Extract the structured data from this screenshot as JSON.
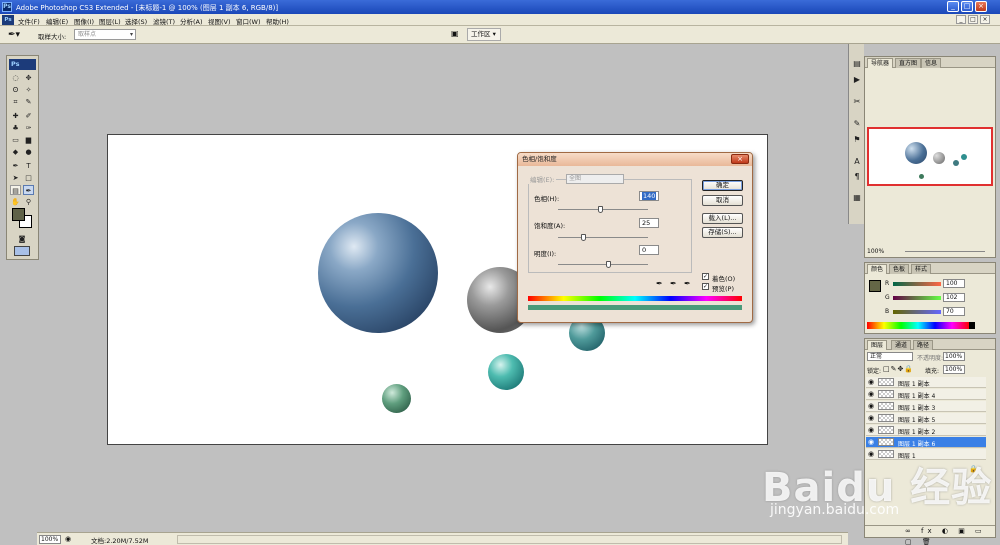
{
  "window": {
    "title": "Adobe Photoshop CS3 Extended - [未标题-1 @ 100% (图层 1 副本 6, RGB/8)]",
    "minimize": "_",
    "maximize": "□",
    "close": "×"
  },
  "menu": {
    "items": [
      "文件(F)",
      "编辑(E)",
      "图像(I)",
      "图层(L)",
      "选择(S)",
      "滤镜(T)",
      "分析(A)",
      "视图(V)",
      "窗口(W)",
      "帮助(H)"
    ],
    "doc_buttons": [
      "_",
      "□",
      "×"
    ]
  },
  "options": {
    "sample_size_label": "取样大小:",
    "sample_size_value": "取样点",
    "workspace_label": "工作区 ▾"
  },
  "toolbox": {
    "logo": "Ps"
  },
  "status": {
    "zoom": "100%",
    "doc_info": "文档:2.20M/7.52M"
  },
  "dialog": {
    "title": "色相/饱和度",
    "edit_label": "编辑(E):",
    "edit_value": "全图",
    "hue_label": "色相(H):",
    "hue_value": "140",
    "saturation_label": "饱和度(A):",
    "saturation_value": "25",
    "lightness_label": "明度(I):",
    "lightness_value": "0",
    "ok": "确定",
    "cancel": "取消",
    "load": "载入(L)...",
    "save": "存储(S)...",
    "colorize_label": "着色(O)",
    "colorize_checked": true,
    "preview_label": "预览(P)",
    "preview_checked": true
  },
  "navigator": {
    "tabs": [
      "导航器",
      "直方图",
      "信息"
    ],
    "zoom": "100%",
    "highlight_color": "#e03030"
  },
  "color_panel": {
    "tabs": [
      "颜色",
      "色板",
      "样式"
    ],
    "r_label": "R",
    "g_label": "G",
    "b_label": "B",
    "r_value": "100",
    "g_value": "102",
    "b_value": "70",
    "fg_color": "#646646"
  },
  "layers_panel": {
    "tabs": [
      "图层",
      "通道",
      "路径"
    ],
    "blend_mode": "正常",
    "opacity_label": "不透明度:",
    "opacity_value": "100%",
    "lock_label": "锁定:",
    "fill_label": "填充:",
    "fill_value": "100%",
    "layers": [
      {
        "name": "图层 1 副本",
        "selected": false
      },
      {
        "name": "图层 1 副本 4",
        "selected": false
      },
      {
        "name": "图层 1 副本 3",
        "selected": false
      },
      {
        "name": "图层 1 副本 5",
        "selected": false
      },
      {
        "name": "图层 1 副本 2",
        "selected": false
      },
      {
        "name": "图层 1 副本 6",
        "selected": true
      },
      {
        "name": "图层 1",
        "selected": false
      }
    ]
  },
  "watermark": {
    "brand": "Baidu 经验",
    "url": "jingyan.baidu.com"
  },
  "colors": {
    "sphere_blue": "#4a6f96",
    "sphere_gray": "#777777",
    "sphere_teal": "#2f8f8f",
    "sphere_green": "#3e7a5c",
    "selected_layer": "#3a80e6"
  }
}
